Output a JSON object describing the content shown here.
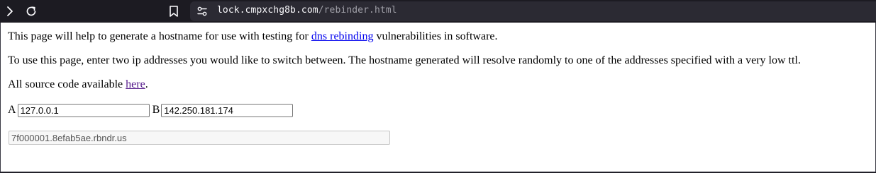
{
  "browser": {
    "url_host": "lock.cmpxchg8b.com",
    "url_path": "/rebinder.html",
    "icons": [
      "chevron-right-icon",
      "reload-icon",
      "bookmark-icon",
      "site-settings-icon"
    ]
  },
  "page": {
    "intro_before": "This page will help to generate a hostname for use with testing for ",
    "intro_link": "dns rebinding",
    "intro_after": " vulnerabilities in software.",
    "instructions": "To use this page, enter two ip addresses you would like to switch between. The hostname generated will resolve randomly to one of the addresses specified with a very low ttl.",
    "source_before": "All source code available ",
    "source_link": "here",
    "source_after": ".",
    "field_a_label": "A",
    "field_a_value": "127.0.0.1",
    "field_b_label": "B",
    "field_b_value": "142.250.181.174",
    "result_value": "7f000001.8efab5ae.rbndr.us"
  },
  "colors": {
    "link": "#0000ee",
    "visited_link": "#551a8b",
    "toolbar_bg": "#1c1b22",
    "urlbar_bg": "#2b2a33"
  }
}
